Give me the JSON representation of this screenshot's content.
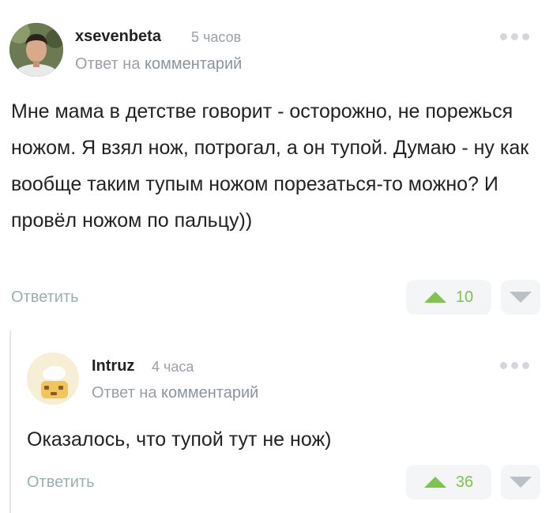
{
  "comments": [
    {
      "author": "xsevenbeta",
      "time": "5 часов",
      "reply_prefix": "Ответ на",
      "reply_link": "комментарий",
      "text": "Мне мама в детстве говорит - осторожно, не порежься ножом. Я взял нож, потрогал, а он тупой. Думаю - ну как вообще таким тупым ножом порезаться-то можно? И провёл ножом по пальцу))",
      "reply_label": "Ответить",
      "rating": "10",
      "avatar_icon": "user-photo-avatar",
      "vote_up_icon": "arrow-up-icon",
      "vote_down_icon": "arrow-down-icon",
      "more_icon": "more-dots-icon"
    },
    {
      "author": "Intruz",
      "time": "4 часа",
      "reply_prefix": "Ответ на",
      "reply_link": "комментарий",
      "text": "Оказалось, что тупой тут не нож)",
      "reply_label": "Ответить",
      "rating": "36",
      "avatar_icon": "cartoon-avatar",
      "vote_up_icon": "arrow-up-icon",
      "vote_down_icon": "arrow-down-icon",
      "more_icon": "more-dots-icon"
    }
  ],
  "colors": {
    "accent_green": "#7ec34e",
    "muted_gray": "#9aa0a6",
    "reply_teal": "#9ab0ad"
  }
}
